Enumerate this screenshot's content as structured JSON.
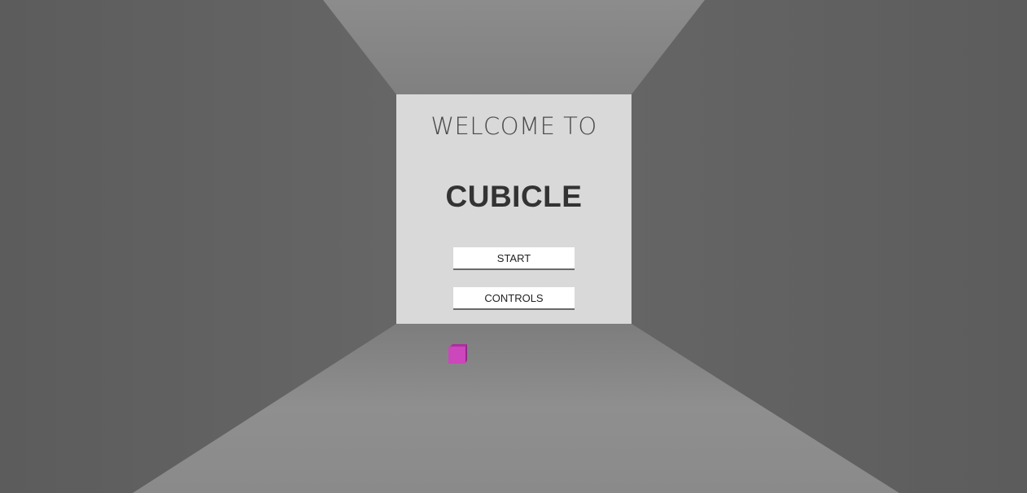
{
  "menu": {
    "welcome_text": "WELCOME TO",
    "game_title": "CUBICLE",
    "start_label": "START",
    "controls_label": "CONTROLS"
  },
  "colors": {
    "back_wall": "#d9d9d9",
    "ceiling": "#888888",
    "floor": "#8e8e8e",
    "side_walls": "#5f5f5f",
    "player_cube": "#cc44bb"
  },
  "icons": {
    "player": "magenta-cube-icon"
  }
}
